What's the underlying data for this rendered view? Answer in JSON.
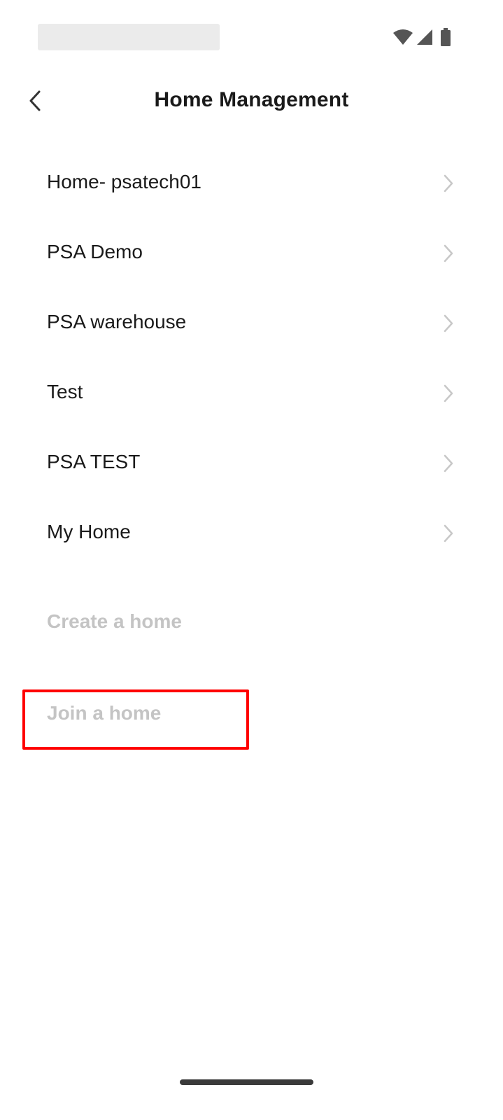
{
  "status_bar": {
    "icons": [
      "wifi-icon",
      "cellular-signal-icon",
      "battery-icon"
    ]
  },
  "header": {
    "back_icon": "chevron-left-icon",
    "title": "Home Management"
  },
  "homes": [
    {
      "label": "Home- psatech01"
    },
    {
      "label": "PSA Demo"
    },
    {
      "label": "PSA warehouse"
    },
    {
      "label": "Test"
    },
    {
      "label": "PSA TEST"
    },
    {
      "label": "My Home"
    }
  ],
  "actions": {
    "create_label": "Create a home",
    "join_label": "Join a home"
  },
  "colors": {
    "text_primary": "#1a1a1a",
    "text_disabled": "#c4c4c4",
    "chevron": "#c8c8c8",
    "highlight": "#ff0000"
  }
}
